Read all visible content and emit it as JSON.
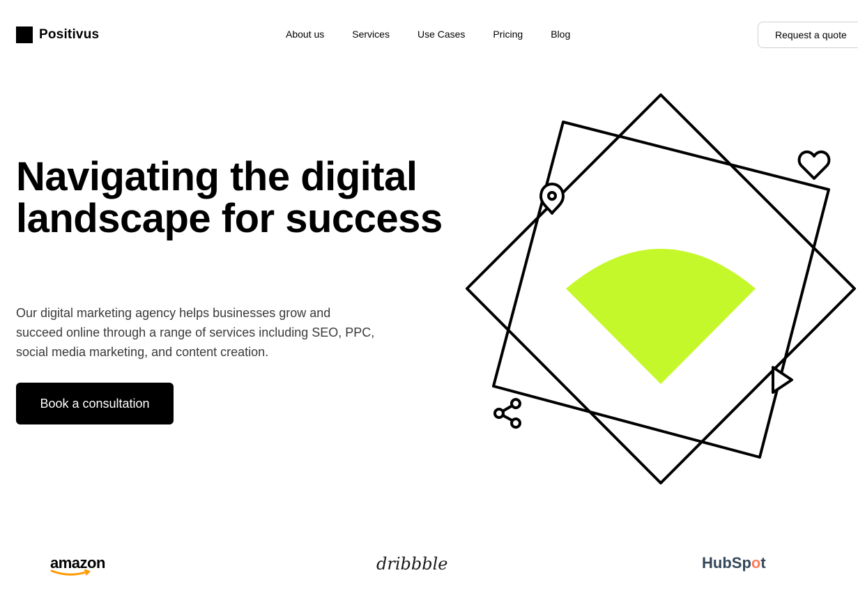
{
  "header": {
    "logo_text": "Positivus",
    "nav": [
      {
        "label": "About us"
      },
      {
        "label": "Services"
      },
      {
        "label": "Use Cases"
      },
      {
        "label": "Pricing"
      },
      {
        "label": "Blog"
      }
    ],
    "quote_button": "Request a quote"
  },
  "hero": {
    "title": "Navigating the digital landscape for success",
    "description": "Our digital marketing agency helps businesses grow and succeed online through a range of services including SEO, PPC, social media marketing, and content creation.",
    "cta": "Book a consultation"
  },
  "illustration": {
    "accent_color": "#C5F82A",
    "icons": [
      "map-pin-icon",
      "heart-icon",
      "play-icon",
      "share-icon"
    ]
  },
  "brands": {
    "amazon": "amazon",
    "dribbble": "dribbble",
    "hubspot_prefix": "HubSp",
    "hubspot_o": "o",
    "hubspot_suffix": "t"
  },
  "colors": {
    "accent": "#C5F82A",
    "text": "#000000",
    "muted": "#3a3a3a"
  }
}
